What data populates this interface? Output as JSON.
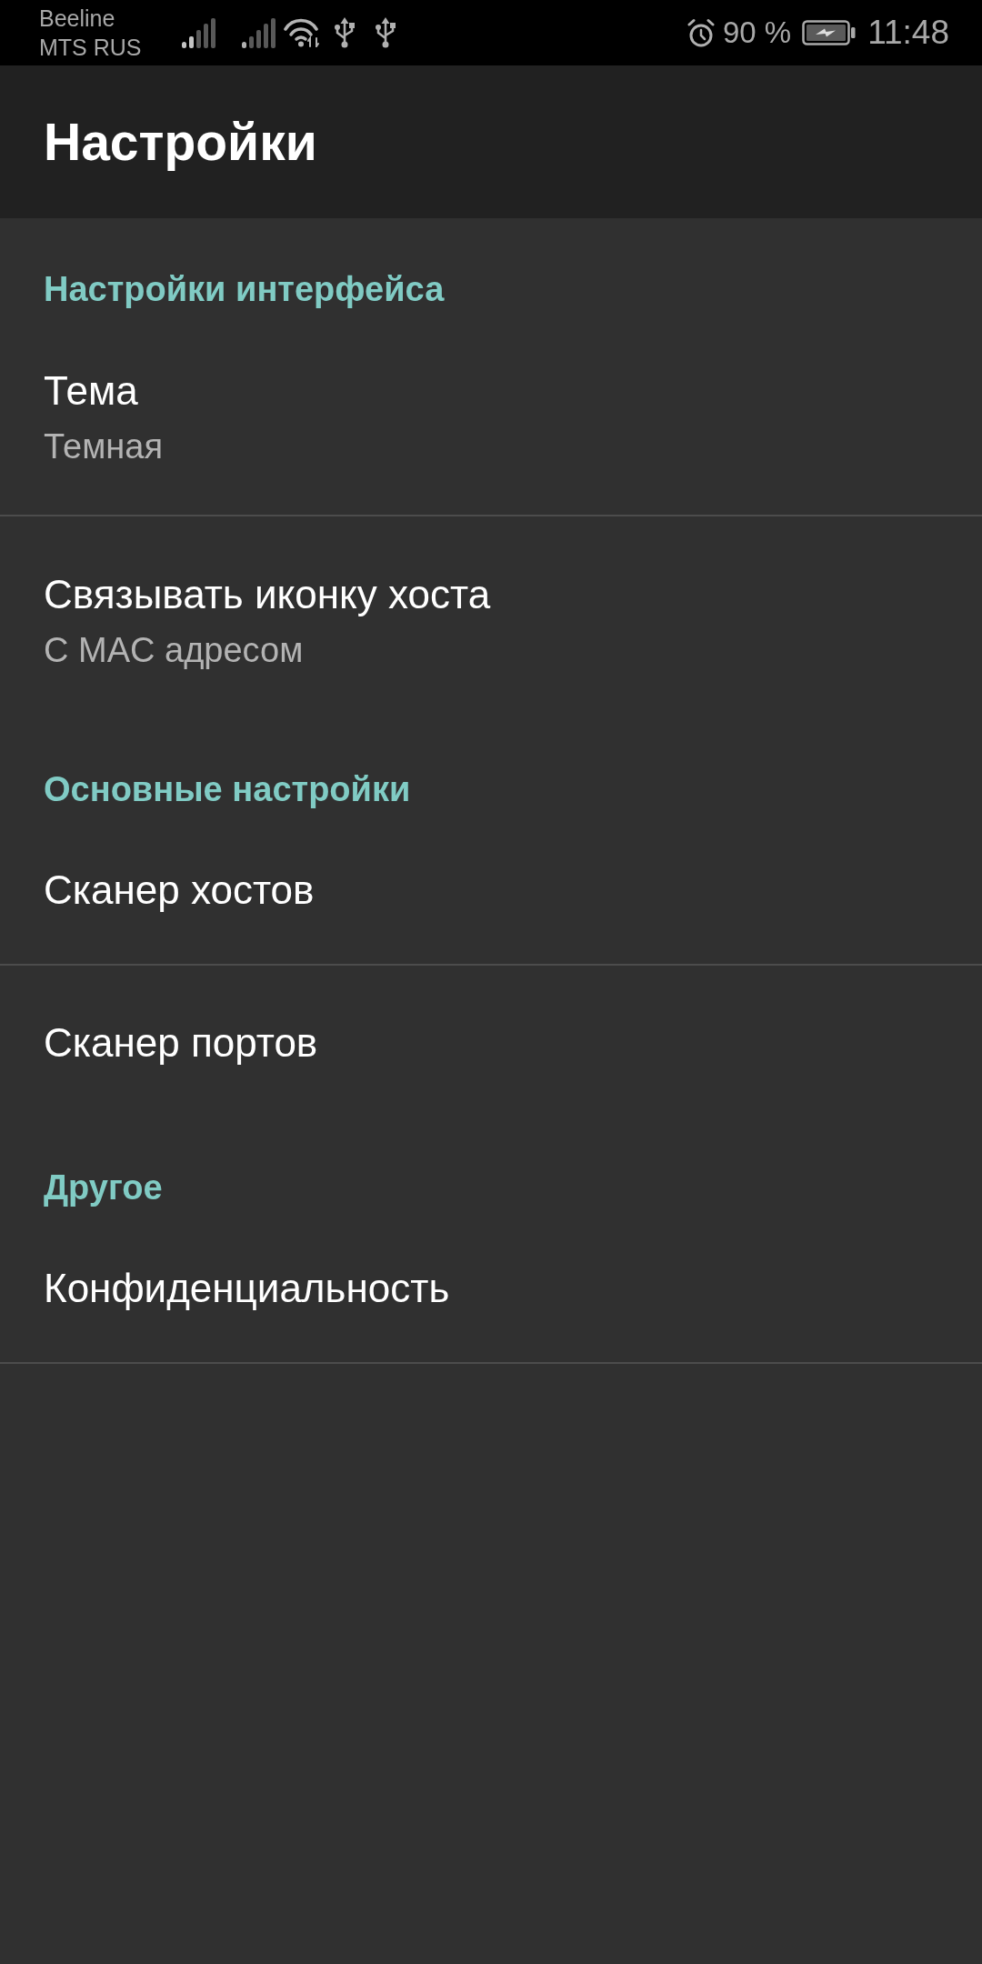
{
  "status_bar": {
    "carriers": [
      "Beeline",
      "MTS RUS"
    ],
    "battery_percent": "90 %",
    "time": "11:48"
  },
  "toolbar": {
    "title": "Настройки"
  },
  "categories": [
    {
      "title": "Настройки интерфейса",
      "items": [
        {
          "title": "Тема",
          "summary": "Темная",
          "divider": true
        },
        {
          "title": "Связывать иконку хоста",
          "summary": "С MAC адресом",
          "divider": false
        }
      ]
    },
    {
      "title": "Основные настройки",
      "items": [
        {
          "title": "Сканер хостов",
          "divider": true
        },
        {
          "title": "Сканер портов",
          "divider": false
        }
      ]
    },
    {
      "title": "Другое",
      "items": [
        {
          "title": "Конфиденциальность",
          "divider": true
        }
      ]
    }
  ]
}
